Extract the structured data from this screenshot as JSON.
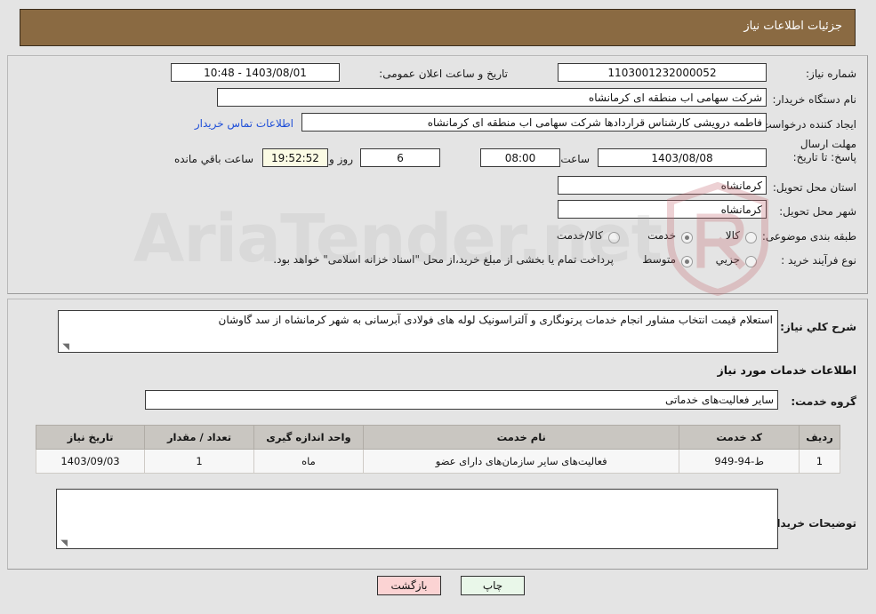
{
  "header": {
    "title": "جزئیات اطلاعات نیاز"
  },
  "watermark": {
    "text": "AriaTender.net",
    "shield_color": "#c46b72"
  },
  "form": {
    "need_number": {
      "label": "شماره نیاز:",
      "value": "1103001232000052"
    },
    "announce_datetime": {
      "label": "تاریخ و ساعت اعلان عمومی:",
      "value": "1403/08/01 - 10:48"
    },
    "buyer_org": {
      "label": "نام دستگاه خریدار:",
      "value": "شرکت سهامی اب منطقه ای کرمانشاه"
    },
    "request_creator": {
      "label": "ایجاد کننده درخواست:",
      "value": "فاطمه درویشی کارشناس قراردادها شرکت سهامی اب منطقه ای کرمانشاه"
    },
    "buyer_contact_link": "اطلاعات تماس خریدار",
    "deadline": {
      "label": "مهلت ارسال پاسخ: تا تاریخ:",
      "date": "1403/08/08",
      "time_label": "ساعت",
      "time": "08:00",
      "days": "6",
      "days_label": "روز و",
      "countdown": "19:52:52",
      "countdown_label": "ساعت باقي مانده"
    },
    "delivery_province": {
      "label": "استان محل تحویل:",
      "value": "کرمانشاه"
    },
    "delivery_city": {
      "label": "شهر محل تحویل:",
      "value": "کرمانشاه"
    },
    "subject_category": {
      "label": "طبقه بندی موضوعی:",
      "options": [
        "کالا",
        "خدمت",
        "کالا/خدمت"
      ],
      "selected": "خدمت"
    },
    "purchase_process": {
      "label": "نوع فرآیند خرید :",
      "options": [
        "جزیي",
        "متوسط"
      ],
      "selected": "متوسط",
      "note": "پرداخت تمام یا بخشی از مبلغ خرید،از محل \"اسناد خزانه اسلامی\" خواهد بود."
    }
  },
  "need_summary": {
    "label": "شرح کلي نياز:",
    "value": "استعلام قیمت انتخاب مشاور انجام خدمات پرتونگاری و آلتراسونیک لوله های فولادی آبرسانی به شهر کرمانشاه از سد گاوشان"
  },
  "services_section": {
    "title": "اطلاعات خدمات مورد نیاز",
    "service_group": {
      "label": "گروه خدمت:",
      "value": "سایر فعالیت‌های خدماتی"
    }
  },
  "table": {
    "columns": [
      "ردیف",
      "کد خدمت",
      "نام خدمت",
      "واحد اندازه گیری",
      "تعداد / مقدار",
      "تاریخ نیاز"
    ],
    "rows": [
      {
        "row": "1",
        "service_code": "ط-94-949",
        "service_name": "فعالیت‌های سایر سازمان‌های دارای عضو",
        "unit": "ماه",
        "quantity": "1",
        "need_date": "1403/09/03"
      }
    ]
  },
  "buyer_notes": {
    "label": "توضیحات خریدار:",
    "value": ""
  },
  "buttons": {
    "print": "چاپ",
    "back": "بازگشت"
  }
}
